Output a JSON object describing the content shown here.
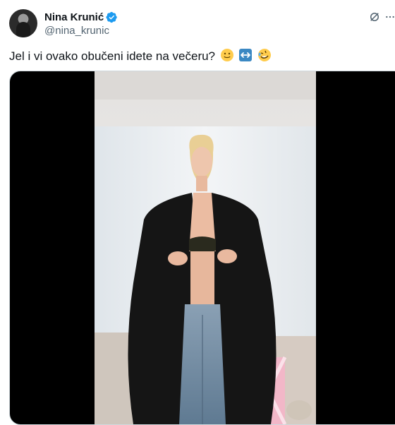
{
  "author": {
    "display_name": "Nina Krunić",
    "handle": "@nina_krunic",
    "verified": true,
    "avatar_icon": "profile-photo"
  },
  "actions": {
    "grok_icon": "grok-icon",
    "more_icon": "more-options-icon"
  },
  "tweet": {
    "text": "Jel i vi ovako obučeni idete na večeru?",
    "emojis": [
      "slightly-smiling-face",
      "left-right-arrow",
      "rolling-on-the-floor-laughing"
    ]
  },
  "media": {
    "type": "video",
    "description_icon": "video-player"
  },
  "colors": {
    "verified_blue": "#1d9bf0",
    "secondary_text": "#536471",
    "border": "#cfd9de"
  }
}
